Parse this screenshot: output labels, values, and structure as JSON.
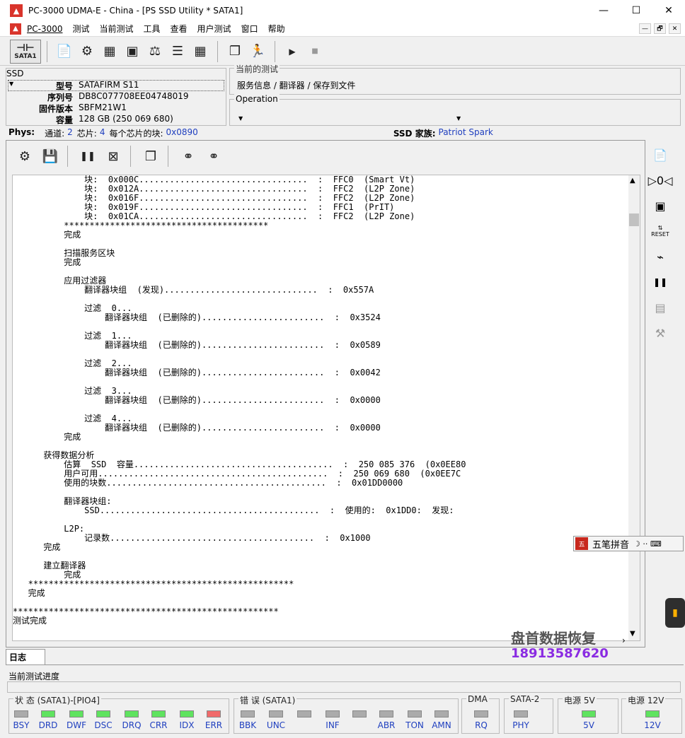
{
  "window": {
    "title": "PC-3000 UDMA-E - China - [PS SSD Utility * SATA1]",
    "app_icon_text": "▲",
    "controls": {
      "minimize": "—",
      "maximize": "☐",
      "close": "✕"
    }
  },
  "menu": {
    "items": [
      "PC-3000",
      "测试",
      "当前测试",
      "工具",
      "查看",
      "用户测试",
      "窗口",
      "帮助"
    ],
    "mdi": [
      "—",
      "🗗",
      "✕"
    ]
  },
  "toolbar": {
    "sata_label": "SATA1",
    "icons": [
      "info-doc-icon",
      "settings-gear-icon",
      "chips-icon",
      "chip-board-icon",
      "scale-icon",
      "list-icon",
      "grid-icon",
      "copy-windows-icon",
      "run-person-icon",
      "play-icon",
      "stop-icon"
    ]
  },
  "ssd": {
    "legend": "SSD",
    "model_label": "型号",
    "model": "SATAFIRM   S11",
    "serial_label": "序列号",
    "serial": "DB8C077708EE04748019",
    "firmware_label": "固件版本",
    "firmware": "SBFM21W1",
    "capacity_label": "容量",
    "capacity": "128 GB (250 069 680)"
  },
  "current_test": {
    "legend": "当前的测试",
    "path": "服务信息 / 翻译器 / 保存到文件"
  },
  "operation": {
    "legend": "Operation"
  },
  "phys": {
    "label": "Phys:",
    "channels_label": "通道:",
    "channels": "2",
    "chips_label": "芯片:",
    "chips": "4",
    "blocks_label": "每个芯片的块:",
    "blocks": "0x0890",
    "family_label": "SSD 家族:",
    "family": "Patriot Spark"
  },
  "log": {
    "lines": [
      "              块:  0x000C.................................  :  FFC0  (Smart Vt)",
      "              块:  0x012A.................................  :  FFC2  (L2P Zone)",
      "              块:  0x016F.................................  :  FFC2  (L2P Zone)",
      "              块:  0x019F.................................  :  FFC1  (PrIT)",
      "              块:  0x01CA.................................  :  FFC2  (L2P Zone)",
      "          ****************************************",
      "          完成",
      "",
      "          扫描服务区块",
      "          完成",
      "",
      "          应用过滤器",
      "              翻译器块组  (发现)..............................  :  0x557A",
      "",
      "              过滤  0...",
      "                  翻译器块组  (已删除的)........................  :  0x3524",
      "",
      "              过滤  1...",
      "                  翻译器块组  (已删除的)........................  :  0x0589",
      "",
      "              过滤  2...",
      "                  翻译器块组  (已删除的)........................  :  0x0042",
      "",
      "              过滤  3...",
      "                  翻译器块组  (已删除的)........................  :  0x0000",
      "",
      "              过滤  4...",
      "                  翻译器块组  (已删除的)........................  :  0x0000",
      "          完成",
      "",
      "      获得数据分析",
      "          估算  SSD  容量.......................................  :  250 085 376  (0x0EE80",
      "          用户可用.............................................  :  250 069 680  (0x0EE7C",
      "          使用的块数...........................................  :  0x01DD0000",
      "",
      "          翻译器块组:",
      "              SSD...........................................  :  使用的:  0x1DD0:  发现:",
      "",
      "          L2P:",
      "              记录数........................................  :  0x1000",
      "      完成",
      "",
      "      建立翻译器",
      "          完成",
      "   ****************************************************",
      "   完成",
      "",
      "****************************************************",
      "测试完成"
    ]
  },
  "ime": {
    "label": "五笔拼音",
    "symbols": "☽ ·· ⌨"
  },
  "watermark": {
    "name": "盘首数据恢复",
    "phone": "18913587620"
  },
  "tab": {
    "label": "日志"
  },
  "progress": {
    "label": "当前测试进度"
  },
  "status_groups": [
    {
      "legend": "状 态 (SATA1)-[PIO4]",
      "leds": [
        {
          "label": "BSY",
          "state": "off"
        },
        {
          "label": "DRD",
          "state": "on"
        },
        {
          "label": "DWF",
          "state": "on"
        },
        {
          "label": "DSC",
          "state": "on"
        },
        {
          "label": "DRQ",
          "state": "on"
        },
        {
          "label": "CRR",
          "state": "on"
        },
        {
          "label": "IDX",
          "state": "on"
        },
        {
          "label": "ERR",
          "state": "red"
        }
      ]
    },
    {
      "legend": "错 误 (SATA1)",
      "leds": [
        {
          "label": "BBK",
          "state": "off"
        },
        {
          "label": "UNC",
          "state": "off"
        },
        {
          "label": "",
          "state": "off"
        },
        {
          "label": "INF",
          "state": "off"
        },
        {
          "label": "",
          "state": "off"
        },
        {
          "label": "ABR",
          "state": "off"
        },
        {
          "label": "TON",
          "state": "off"
        },
        {
          "label": "AMN",
          "state": "off"
        }
      ]
    },
    {
      "legend": "DMA",
      "leds": [
        {
          "label": "RQ",
          "state": "off"
        }
      ]
    },
    {
      "legend": "SATA-2",
      "leds": [
        {
          "label": "PHY",
          "state": "off"
        }
      ]
    },
    {
      "legend": "电源 5V",
      "leds": [
        {
          "label": "5V",
          "state": "on"
        }
      ]
    },
    {
      "legend": "电源 12V",
      "leds": [
        {
          "label": "12V",
          "state": "on"
        }
      ]
    }
  ]
}
